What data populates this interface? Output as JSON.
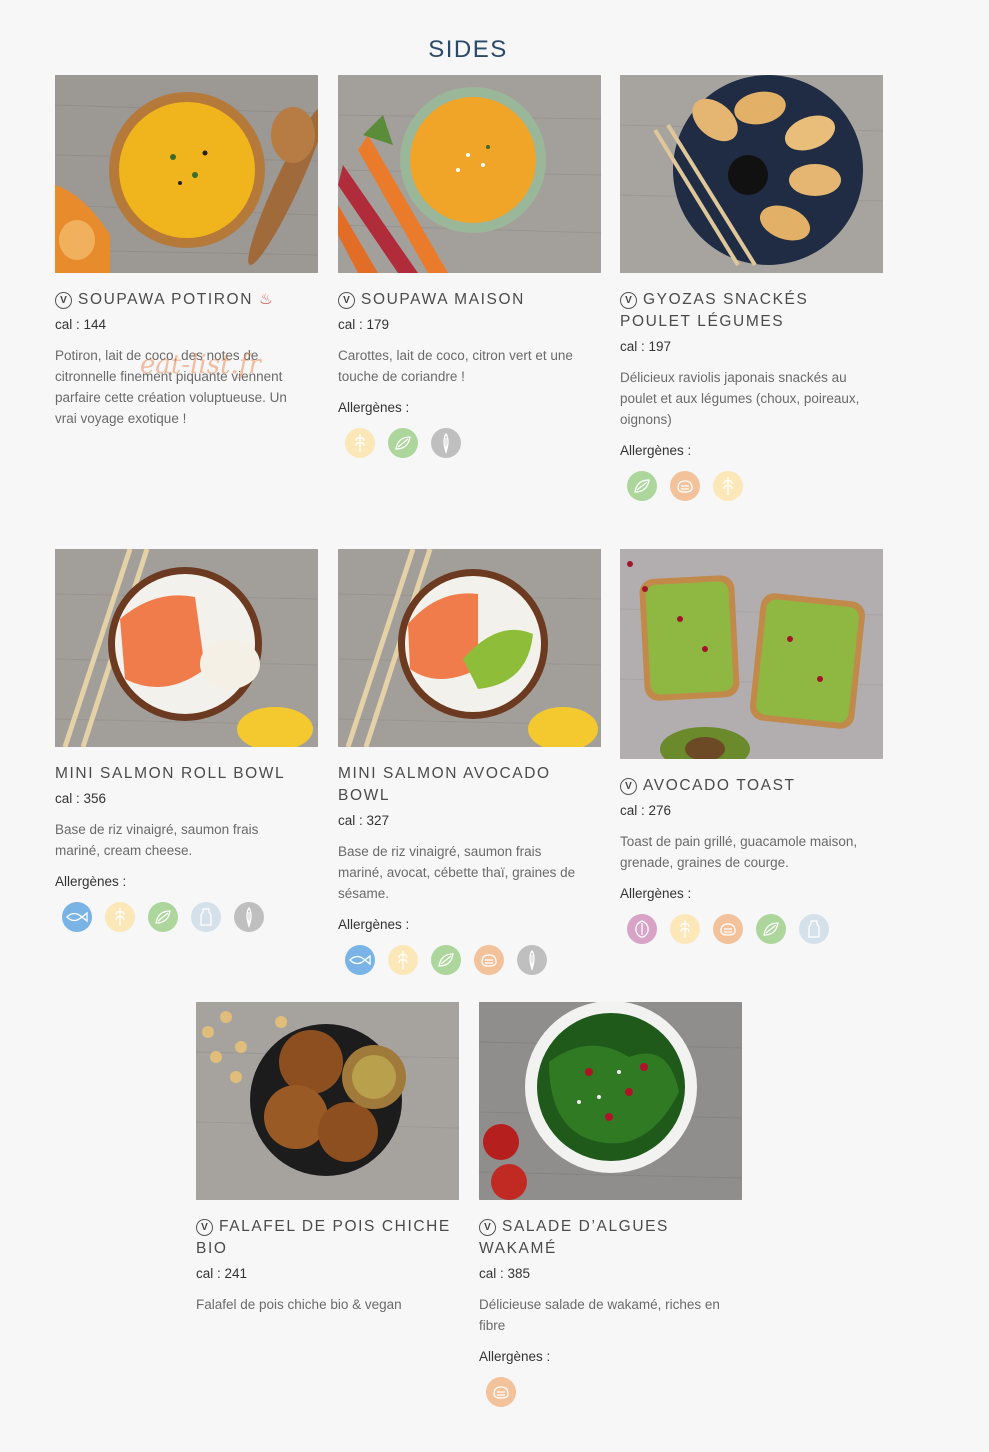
{
  "page": {
    "title": "SIDES",
    "watermark": "eat-list.fr"
  },
  "labels": {
    "allergens": "Allergènes :",
    "vegetarian_badge": "v"
  },
  "allergen_colors": {
    "fish": "#7ab4e6",
    "gluten": "#fbe7b8",
    "soy": "#acd69c",
    "sesame": "#bfbfbf",
    "egg": "#f4c29a",
    "milk": "#d4e1ea",
    "nuts": "#d8a3c6"
  },
  "items": [
    {
      "title": "SOUPAWA POTIRON",
      "veg": true,
      "hot": "♨",
      "cal": "cal : 144",
      "description": "Potiron, lait de coco, des notes de citronnelle finement piquante viennent parfaire cette création voluptueuse. Un vrai voyage exotique !",
      "allergens": []
    },
    {
      "title": "SOUPAWA MAISON",
      "veg": true,
      "cal": "cal : 179",
      "description": "Carottes, lait de coco, citron vert et une touche de coriandre !",
      "allergens": [
        "gluten-icon",
        "soy-icon",
        "sesame-icon"
      ]
    },
    {
      "title": "GYOZAS SNACKÉS POULET LÉGUMES",
      "veg": true,
      "cal": "cal : 197",
      "description": "Délicieux raviolis japonais snackés au poulet et aux légumes (choux, poireaux, oignons)",
      "allergens": [
        "soy-icon",
        "egg-icon",
        "gluten-icon"
      ]
    },
    {
      "title": "MINI SALMON ROLL BOWL",
      "veg": false,
      "cal": "cal : 356",
      "description": "Base de riz vinaigré, saumon frais mariné, cream cheese.",
      "allergens": [
        "fish-icon",
        "gluten-icon",
        "soy-icon",
        "milk-icon",
        "sesame-icon"
      ]
    },
    {
      "title": "MINI SALMON AVOCADO BOWL",
      "veg": false,
      "cal": "cal : 327",
      "description": "Base de riz vinaigré, saumon frais mariné, avocat, cébette thaï, graines de sésame.",
      "allergens": [
        "fish-icon",
        "gluten-icon",
        "soy-icon",
        "egg-icon",
        "sesame-icon"
      ]
    },
    {
      "title": "AVOCADO TOAST",
      "veg": true,
      "cal": "cal : 276",
      "description": "Toast de pain grillé, guacamole maison, grenade, graines de courge.",
      "allergens": [
        "nuts-icon",
        "gluten-icon",
        "egg-icon",
        "soy-icon",
        "milk-icon"
      ]
    },
    {
      "title": "FALAFEL DE POIS CHICHE BIO",
      "veg": true,
      "cal": "cal : 241",
      "description": "Falafel de pois chiche bio & vegan",
      "allergens": []
    },
    {
      "title": "SALADE D’ALGUES WAKAMÉ",
      "veg": true,
      "cal": "cal : 385",
      "description": "Délicieuse salade de wakamé, riches en fibre",
      "allergens": [
        "egg-icon"
      ]
    }
  ]
}
